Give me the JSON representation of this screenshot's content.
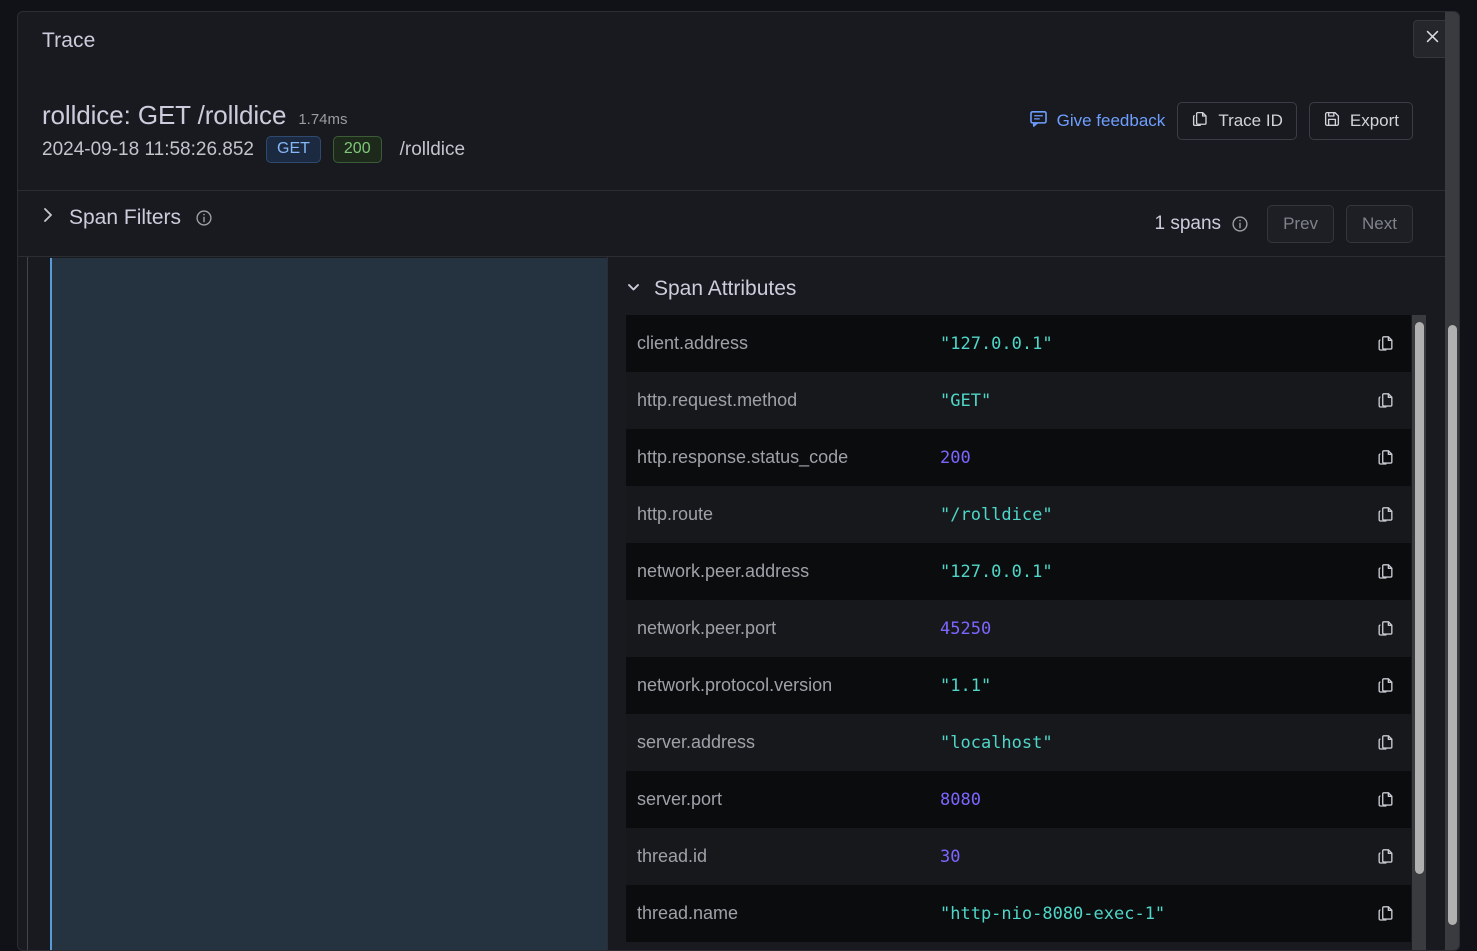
{
  "dialog": {
    "title": "Trace",
    "close_label": "Close"
  },
  "trace": {
    "name": "rolldice: GET /rolldice",
    "duration": "1.74ms",
    "timestamp": "2024-09-18 11:58:26.852",
    "method_badge": "GET",
    "status_badge": "200",
    "route": "/rolldice",
    "method_badge_color": "#85b6f5",
    "status_badge_color": "#7ec77a"
  },
  "header_actions": {
    "feedback_label": "Give feedback",
    "feedback_color": "#6e9fff",
    "trace_id_label": "Trace ID",
    "export_label": "Export"
  },
  "filter_bar": {
    "span_filters_label": "Span Filters",
    "spans_count": "1 spans",
    "prev_label": "Prev",
    "next_label": "Next"
  },
  "attributes": {
    "section_label": "Span Attributes",
    "rows": [
      {
        "key": "client.address",
        "value": "\"127.0.0.1\"",
        "type": "str"
      },
      {
        "key": "http.request.method",
        "value": "\"GET\"",
        "type": "str"
      },
      {
        "key": "http.response.status_code",
        "value": "200",
        "type": "num"
      },
      {
        "key": "http.route",
        "value": "\"/rolldice\"",
        "type": "str"
      },
      {
        "key": "network.peer.address",
        "value": "\"127.0.0.1\"",
        "type": "str"
      },
      {
        "key": "network.peer.port",
        "value": "45250",
        "type": "num"
      },
      {
        "key": "network.protocol.version",
        "value": "\"1.1\"",
        "type": "str"
      },
      {
        "key": "server.address",
        "value": "\"localhost\"",
        "type": "str"
      },
      {
        "key": "server.port",
        "value": "8080",
        "type": "num"
      },
      {
        "key": "thread.id",
        "value": "30",
        "type": "num"
      },
      {
        "key": "thread.name",
        "value": "\"http-nio-8080-exec-1\"",
        "type": "str"
      }
    ],
    "copy_label": "Copy value"
  },
  "waterfall": {
    "selected_span_color": "#25323f",
    "selected_span_accent": "#5a9ad6"
  }
}
